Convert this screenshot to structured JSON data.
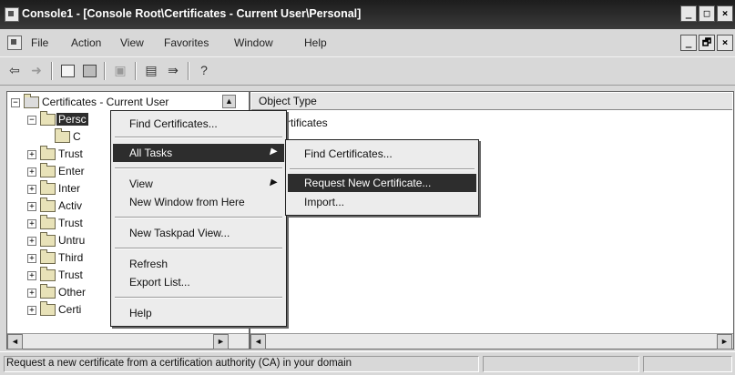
{
  "window": {
    "title": "Console1 - [Console Root\\Certificates - Current User\\Personal]",
    "controls": [
      "_",
      "□",
      "×"
    ]
  },
  "menubar": {
    "items": [
      "File",
      "Action",
      "View",
      "Favorites",
      "Window",
      "Help"
    ],
    "child_controls": [
      "_",
      "🗗",
      "×"
    ]
  },
  "toolbar": {
    "buttons": [
      "back-icon",
      "forward-icon",
      "up-icon",
      "show-hide-tree-icon",
      "delete-icon",
      "properties-icon",
      "export-icon",
      "help-icon"
    ]
  },
  "tree": {
    "root": "Certificates - Current User",
    "items": [
      {
        "label": "Persc",
        "expanded": true,
        "selected": true
      },
      {
        "label": "C",
        "child": true
      },
      {
        "label": "Trust"
      },
      {
        "label": "Enter"
      },
      {
        "label": "Inter"
      },
      {
        "label": "Activ"
      },
      {
        "label": "Trust"
      },
      {
        "label": "Untru"
      },
      {
        "label": "Third"
      },
      {
        "label": "Trust"
      },
      {
        "label": "Other"
      },
      {
        "label": "Certi"
      }
    ]
  },
  "list": {
    "column": "Object Type",
    "rows": [
      "rtificates"
    ]
  },
  "context_menu": {
    "items": [
      {
        "label": "Find Certificates...",
        "submenu": false
      },
      {
        "label": "All Tasks",
        "submenu": true,
        "selected": true
      },
      {
        "label": "View",
        "submenu": true
      },
      {
        "label": "New Window from Here",
        "submenu": false
      },
      {
        "label": "New Taskpad View...",
        "submenu": false
      },
      {
        "label": "Refresh",
        "submenu": false
      },
      {
        "label": "Export List...",
        "submenu": false
      },
      {
        "label": "Help",
        "submenu": false
      }
    ]
  },
  "submenu": {
    "items": [
      {
        "label": "Find Certificates...",
        "selected": false
      },
      {
        "label": "Request New Certificate...",
        "selected": true
      },
      {
        "label": "Import...",
        "selected": false
      }
    ]
  },
  "status": {
    "text": "Request a new certificate from a certification authority (CA) in your domain"
  },
  "colors": {
    "titlebar": "#2a2a2a",
    "menu_highlight": "#2d2d2d",
    "window_bg": "#d8d8d8"
  }
}
